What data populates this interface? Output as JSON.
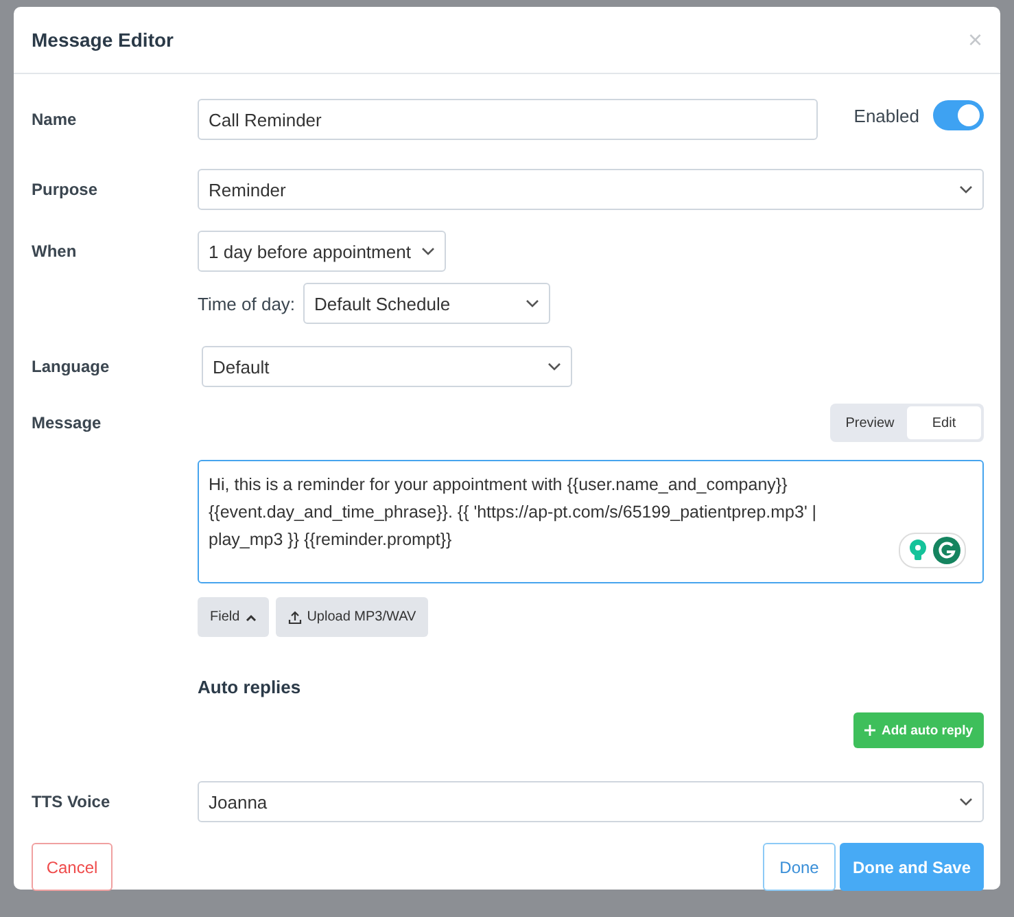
{
  "dialog": {
    "title": "Message Editor",
    "close": "×"
  },
  "name": {
    "label": "Name",
    "value": "Call Reminder"
  },
  "enabled": {
    "label": "Enabled",
    "on": true
  },
  "purpose": {
    "label": "Purpose",
    "value": "Reminder"
  },
  "when": {
    "label": "When",
    "value": "1 day before appointment"
  },
  "time_of_day": {
    "label": "Time of day:",
    "value": "Default Schedule"
  },
  "language": {
    "label": "Language",
    "value": "Default"
  },
  "message": {
    "label": "Message",
    "view_tabs": [
      {
        "label": "Preview",
        "selected": false
      },
      {
        "label": "Edit",
        "selected": true
      }
    ],
    "text": "Hi, this is a reminder for your appointment with {{user.name_and_company}} {{event.day_and_time_phrase}}. {{ 'https://ap-pt.com/s/65199_patientprep.mp3' | play_mp3 }} {{reminder.prompt}}"
  },
  "tool_buttons": [
    {
      "kind": "menu",
      "label": "Field",
      "expanded": true
    },
    {
      "kind": "upload",
      "label": "Upload MP3/WAV"
    }
  ],
  "auto_replies": {
    "title": "Auto replies",
    "add_button": "Add auto reply"
  },
  "tts_voice": {
    "label": "TTS Voice",
    "value": "Joanna"
  },
  "footer": {
    "cancel": "Cancel",
    "done": "Done",
    "done_and_save": "Done and Save"
  }
}
